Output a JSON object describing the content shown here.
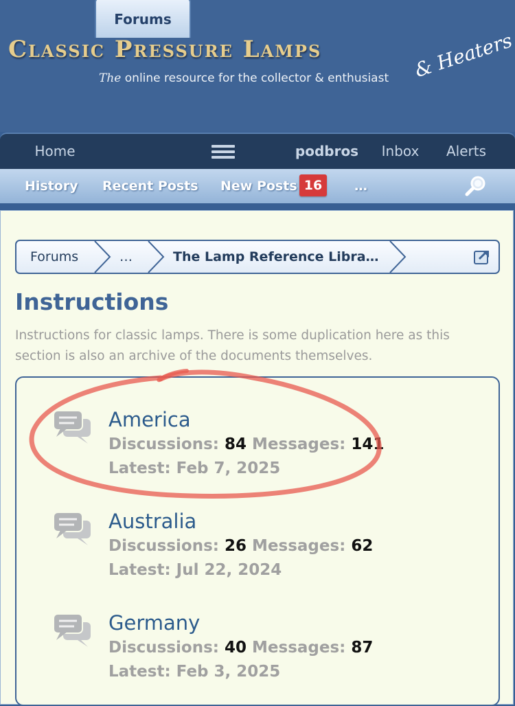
{
  "header": {
    "logo_title": "Classic Pressure Lamps",
    "logo_tagline_prefix": "The",
    "logo_tagline_rest": " online resource for the collector & enthusiast",
    "logo_heaters": "& Heaters"
  },
  "nav": {
    "home": "Home",
    "forums": "Forums",
    "menu_icon": "hamburger-menu-icon",
    "user": "podbros",
    "inbox": "Inbox",
    "alerts": "Alerts"
  },
  "subnav": {
    "history": "History",
    "recent_posts": "Recent Posts",
    "new_posts": "New Posts",
    "new_posts_count": "16",
    "more": "…",
    "search_icon": "magnifier-icon"
  },
  "breadcrumb": {
    "items": [
      "Forums",
      "…",
      "The Lamp Reference Libra…"
    ],
    "jump_icon": "external-jump-icon"
  },
  "page": {
    "title": "Instructions",
    "description": "Instructions for classic lamps. There is some duplication here as this section is also an archive of the documents themselves."
  },
  "nodes": [
    {
      "title": "America",
      "discussions_label": "Discussions:",
      "discussions": "84",
      "messages_label": "Messages:",
      "messages": "141",
      "latest": "Latest: Feb 7, 2025"
    },
    {
      "title": "Australia",
      "discussions_label": "Discussions:",
      "discussions": "26",
      "messages_label": "Messages:",
      "messages": "62",
      "latest": "Latest: Jul 22, 2024"
    },
    {
      "title": "Germany",
      "discussions_label": "Discussions:",
      "discussions": "40",
      "messages_label": "Messages:",
      "messages": "87",
      "latest": "Latest: Feb 3, 2025"
    }
  ],
  "colors": {
    "header_bg": "#3f6496",
    "nav_bg": "#233c5c",
    "content_bg": "#f8fbea",
    "link": "#2c5b8c",
    "badge": "#d63a3a",
    "annotation": "#e85a4f"
  }
}
